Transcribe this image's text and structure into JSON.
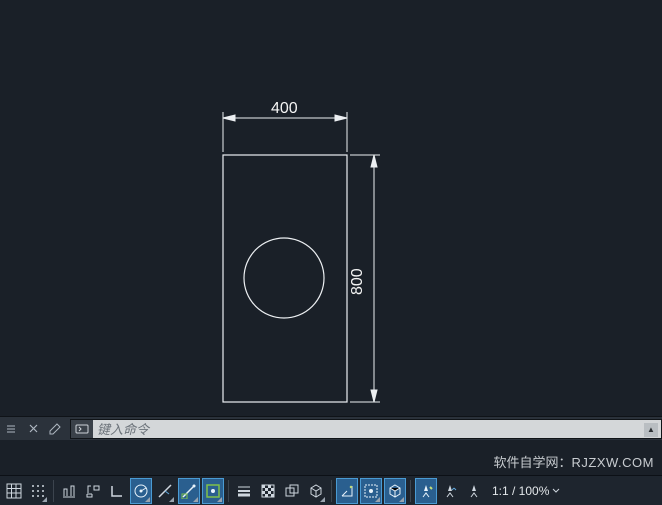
{
  "drawing": {
    "dim_width": "400",
    "dim_height": "800"
  },
  "command": {
    "placeholder": "键入命令"
  },
  "watermark": {
    "label": "软件自学网：",
    "url": "RJZXW.COM"
  },
  "status": {
    "zoom": "1:1 / 100%"
  },
  "icons": {
    "grid": "grid-icon",
    "dots": "dots-icon",
    "snap": "snap-icon",
    "ortho": "ortho-icon",
    "polar": "polar-icon",
    "osnap": "osnap-icon",
    "track": "track-icon",
    "dyn": "dyn-icon",
    "lwt": "lwt-icon",
    "transp": "transp-icon",
    "sel": "sel-icon",
    "cycle": "cycle-icon",
    "dim3d": "dim3d-icon",
    "nav": "nav-icon",
    "d1": "d1-icon",
    "d2": "d2-icon",
    "d3": "d3-icon",
    "person": "person-icon",
    "arrowdown": "arrow-down-icon"
  }
}
